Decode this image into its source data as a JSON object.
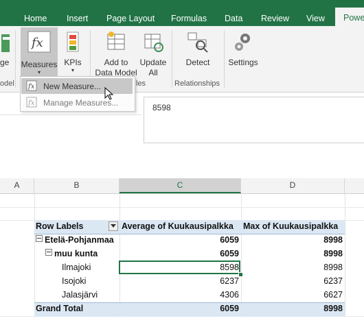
{
  "ribbon_tabs": [
    "Home",
    "Insert",
    "Page Layout",
    "Formulas",
    "Data",
    "Review",
    "View",
    "Powe"
  ],
  "ribbon": {
    "partial_left_label": "ge",
    "measures_label": "Measures",
    "kpis_label": "KPIs",
    "add_to_data_model_line1": "Add to",
    "add_to_data_model_line2": "Data Model",
    "update_all_line1": "Update",
    "update_all_line2": "All",
    "detect_label": "Detect",
    "settings_label": "Settings",
    "group_model_partial": "odel",
    "group_tables_partial": "les",
    "group_relationships": "Relationships"
  },
  "dropdown": {
    "new_measure": "New Measure...",
    "manage_measures": "Manage Measures..."
  },
  "formula_bar": {
    "value": "8598"
  },
  "columns": [
    "A",
    "B",
    "C",
    "D"
  ],
  "pivot": {
    "headers": [
      "Row Labels",
      "Average of Kuukausipalkka",
      "Max of Kuukausipalkka"
    ],
    "rows": [
      {
        "label": "Etelä-Pohjanmaa",
        "avg": "6059",
        "max": "8998"
      },
      {
        "label": "muu kunta",
        "avg": "6059",
        "max": "8998"
      },
      {
        "label": "Ilmajoki",
        "avg": "8598",
        "max": "8998"
      },
      {
        "label": "Isojoki",
        "avg": "6237",
        "max": "6237"
      },
      {
        "label": "Jalasjärvi",
        "avg": "4306",
        "max": "6627"
      }
    ],
    "grand_total": {
      "label": "Grand Total",
      "avg": "6059",
      "max": "8998"
    }
  },
  "colors": {
    "excel_green": "#217346",
    "pivot_header_band": "#dbe7f3"
  }
}
